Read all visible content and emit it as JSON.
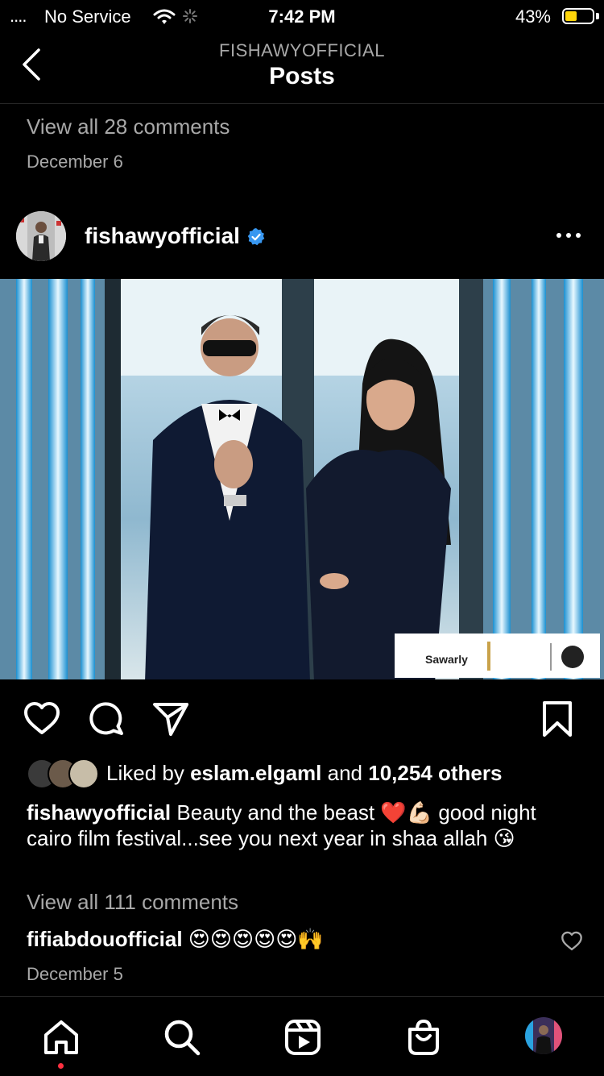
{
  "status_bar": {
    "signal": "....",
    "carrier": "No Service",
    "time": "7:42 PM",
    "battery_percent": "43%",
    "battery_level": 0.43,
    "battery_color": "#ffd60a"
  },
  "header": {
    "subtitle": "FISHAWYOFFICIAL",
    "title": "Posts",
    "back_icon": "chevron-left-icon"
  },
  "previous_post": {
    "view_comments": "View all 28 comments",
    "date": "December 6"
  },
  "post": {
    "username": "fishawyofficial",
    "verified_icon": "verified-badge-icon",
    "more_icon": "more-horizontal-icon",
    "image_overlay_text": "Sawarly",
    "actions": [
      "heart-icon",
      "comment-icon",
      "share-icon",
      "bookmark-icon"
    ],
    "likes": {
      "prefix": "Liked by",
      "user": "eslam.elgaml",
      "middle": "and",
      "others": "10,254 others"
    },
    "caption": {
      "username": "fishawyofficial",
      "text": "Beauty and the beast ❤️💪🏻 good night cairo film festival...see you next year in shaa allah 😘"
    },
    "view_comments": "View all 111 comments",
    "comment": {
      "username": "fifiabdouofficial",
      "text": "😍😍😍😍😍🙌"
    },
    "date": "December 5"
  },
  "tab_bar": {
    "tabs": [
      "home-icon",
      "search-icon",
      "reels-icon",
      "shop-icon",
      "profile-avatar"
    ],
    "active": "home-icon",
    "notification_color": "#ff3040"
  },
  "colors": {
    "background": "#000000",
    "text": "#ffffff",
    "secondary_text": "#a8a8a8",
    "verified": "#3897f0"
  }
}
